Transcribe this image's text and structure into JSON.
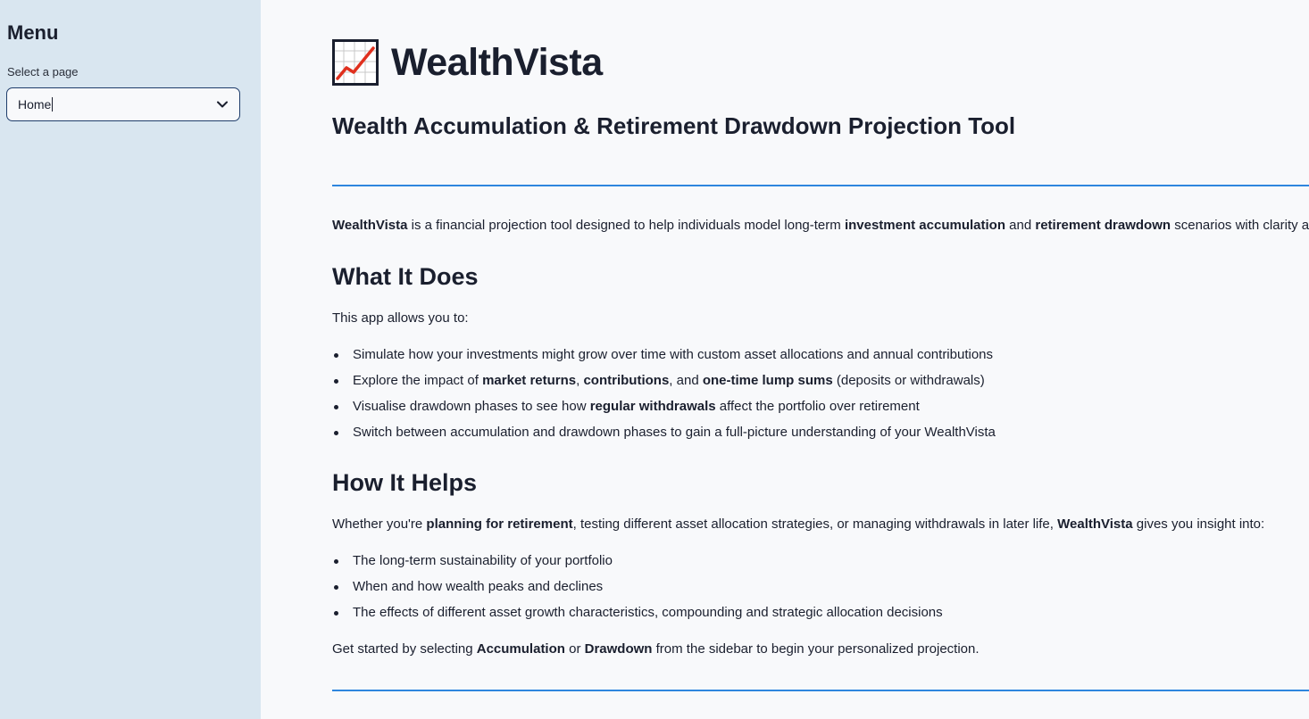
{
  "sidebar": {
    "title": "Menu",
    "select_label": "Select a page",
    "select_value": "Home"
  },
  "main": {
    "app_title": "WealthVista",
    "title_icon": "chart-increasing-icon",
    "subtitle": "Wealth Accumulation & Retirement Drawdown Projection Tool",
    "intro": {
      "p1": "WealthVista",
      "p2": " is a financial projection tool designed to help individuals model long-term ",
      "p3": "investment accumulation",
      "p4": " and ",
      "p5": "retirement drawdown",
      "p6": " scenarios with clarity an"
    },
    "what": {
      "heading": "What It Does",
      "lead": "This app allows you to:",
      "b1": "Simulate how your investments might grow over time with custom asset allocations and annual contributions",
      "b2": {
        "t1": "Explore the impact of ",
        "t2": "market returns",
        "t3": ", ",
        "t4": "contributions",
        "t5": ", and ",
        "t6": "one-time lump sums",
        "t7": " (deposits or withdrawals)"
      },
      "b3": {
        "t1": "Visualise drawdown phases to see how ",
        "t2": "regular withdrawals",
        "t3": " affect the portfolio over retirement"
      },
      "b4": "Switch between accumulation and drawdown phases to gain a full-picture understanding of your WealthVista"
    },
    "how": {
      "heading": "How It Helps",
      "lead": {
        "t1": "Whether you're ",
        "t2": "planning for retirement",
        "t3": ", testing different asset allocation strategies, or managing withdrawals in later life, ",
        "t4": "WealthVista",
        "t5": " gives you insight into:"
      },
      "b1": "The long-term sustainability of your portfolio",
      "b2": "When and how wealth peaks and declines",
      "b3": "The effects of different asset growth characteristics, compounding and strategic allocation decisions",
      "closing": {
        "t1": "Get started by selecting ",
        "t2": "Accumulation",
        "t3": " or ",
        "t4": "Drawdown",
        "t5": " from the sidebar to begin your personalized projection."
      }
    }
  },
  "colors": {
    "sidebar_bg": "#d9e6f0",
    "main_bg": "#f8f9fb",
    "accent_rule": "#2e86de",
    "text": "#1a1f2e"
  }
}
